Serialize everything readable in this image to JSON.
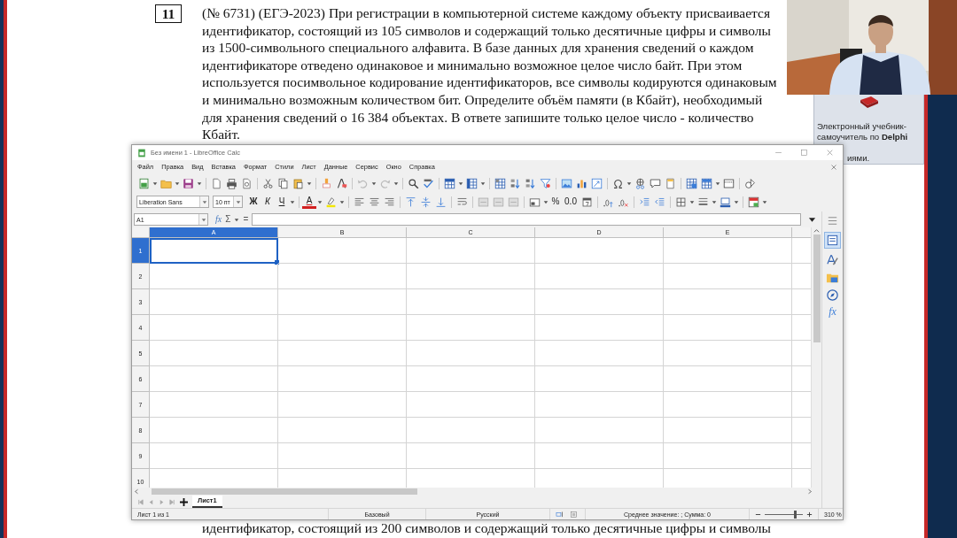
{
  "document": {
    "number": "11",
    "lines": [
      "(№ 6731) (ЕГЭ-2023) При регистрации в компьютерной системе каждому объекту присваивается",
      "идентификатор, состоящий из 105 символов и содержащий только десятичные цифры и символы",
      "из 1500-символьного специального алфавита. В базе данных для хранения сведений о каждом",
      "идентификаторе отведено одинаковое и минимально возможное целое число байт. При этом",
      "используется посимвольное кодирование идентификаторов, все символы кодируются одинаковым",
      "и минимально возможным количеством бит. Определите объём памяти (в Кбайт), необходимый",
      "для хранения сведений о 16 384 объектах. В ответе запишите только целое число - количество",
      "Кбайт."
    ],
    "continuation": "идентификатор, состоящий из 200 символов и содержащий только десятичные цифры и символы"
  },
  "ad": {
    "text": "Электронный учебник-самоучитель по **Delphi**",
    "tail": "иями."
  },
  "calc": {
    "title": "Без имени 1 - LibreOffice Calc",
    "menu": [
      "Файл",
      "Правка",
      "Вид",
      "Вставка",
      "Формат",
      "Стили",
      "Лист",
      "Данные",
      "Сервис",
      "Окно",
      "Справка"
    ],
    "font_name": "Liberation Sans",
    "font_size": "10 пт",
    "format_buttons": [
      "Ж",
      "К",
      "Ч"
    ],
    "font_color_label": "A",
    "number_buttons": [
      "%",
      "0.0"
    ],
    "name_box": "A1",
    "formula_buttons": [
      "fx",
      "Σ",
      "="
    ],
    "columns": [
      {
        "label": "A",
        "selected": true
      },
      {
        "label": "B",
        "selected": false
      },
      {
        "label": "C",
        "selected": false
      },
      {
        "label": "D",
        "selected": false
      },
      {
        "label": "E",
        "selected": false
      }
    ],
    "rows": [
      {
        "label": "1",
        "selected": true
      },
      {
        "label": "2",
        "selected": false
      },
      {
        "label": "3",
        "selected": false
      },
      {
        "label": "4",
        "selected": false
      },
      {
        "label": "5",
        "selected": false
      },
      {
        "label": "6",
        "selected": false
      },
      {
        "label": "7",
        "selected": false
      },
      {
        "label": "8",
        "selected": false
      },
      {
        "label": "9",
        "selected": false
      },
      {
        "label": "10",
        "selected": false
      }
    ],
    "sheet_tabs": [
      {
        "label": "Лист1",
        "selected": true
      }
    ],
    "status": [
      "Лист 1 из 1",
      "Базовый",
      "Русский",
      "Среднее значение: ; Сумма: 0"
    ],
    "zoom": {
      "level": 0.8,
      "reading": "310 %"
    },
    "sidebar_function_label": "fx"
  }
}
